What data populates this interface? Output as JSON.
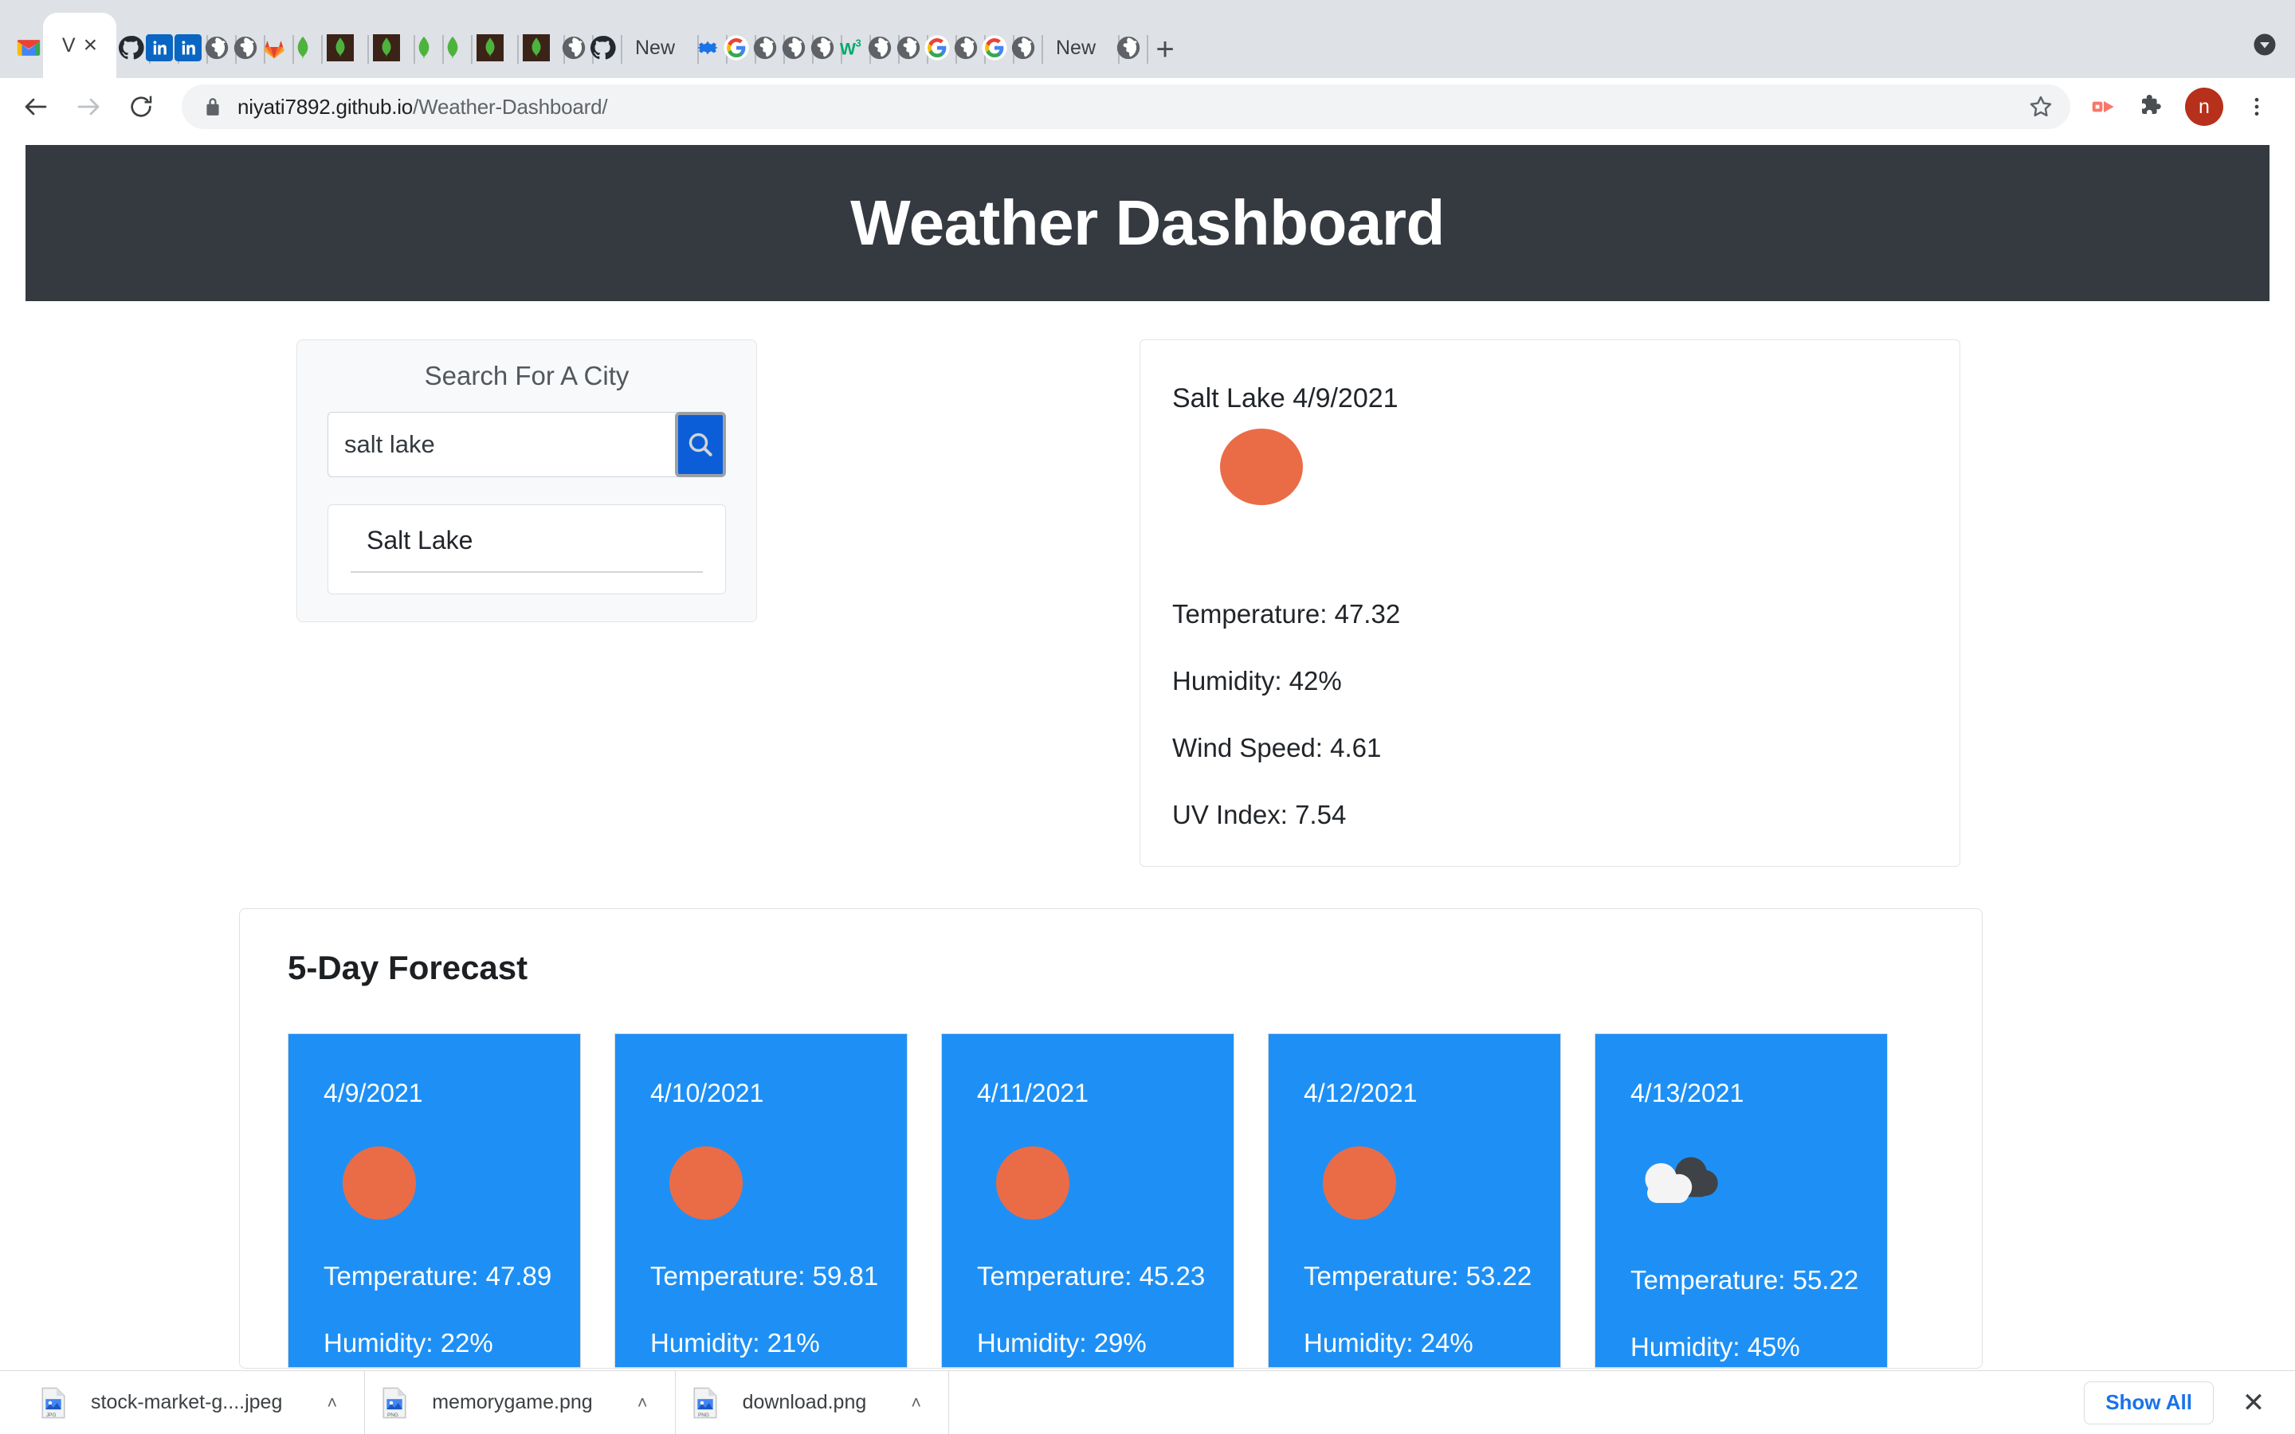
{
  "browser": {
    "tabs": [
      {
        "icon": "gmail-icon",
        "label": ""
      },
      {
        "icon": "favicon-generic",
        "label": "",
        "pinned": true
      },
      {
        "icon": "github-icon",
        "label": ""
      },
      {
        "icon": "linkedin-icon",
        "label": ""
      },
      {
        "icon": "linkedin-icon",
        "label": ""
      },
      {
        "icon": "globe-icon",
        "label": ""
      },
      {
        "icon": "globe-icon",
        "label": ""
      },
      {
        "icon": "gitlab-icon",
        "label": ""
      },
      {
        "icon": "mongodb-icon",
        "label": ""
      },
      {
        "icon": "mongodb-dark-icon",
        "label": ""
      },
      {
        "icon": "mongodb-dark-icon",
        "label": ""
      },
      {
        "icon": "mongodb-icon",
        "label": ""
      },
      {
        "icon": "mongodb-icon",
        "label": ""
      },
      {
        "icon": "mongodb-dark-icon",
        "label": ""
      },
      {
        "icon": "mongodb-dark-icon",
        "label": ""
      },
      {
        "icon": "globe-icon",
        "label": ""
      },
      {
        "icon": "github-icon",
        "label": ""
      },
      {
        "icon": "text-tab",
        "label": "New"
      },
      {
        "icon": "gear-blue-icon",
        "label": ""
      },
      {
        "icon": "google-icon",
        "label": ""
      },
      {
        "icon": "globe-icon",
        "label": ""
      },
      {
        "icon": "globe-icon",
        "label": ""
      },
      {
        "icon": "globe-icon",
        "label": ""
      },
      {
        "icon": "w3schools-icon",
        "label": ""
      },
      {
        "icon": "globe-icon",
        "label": ""
      },
      {
        "icon": "globe-icon",
        "label": ""
      },
      {
        "icon": "google-icon",
        "label": ""
      },
      {
        "icon": "globe-icon",
        "label": ""
      },
      {
        "icon": "google-icon",
        "label": ""
      },
      {
        "icon": "globe-icon",
        "label": ""
      },
      {
        "icon": "text-tab",
        "label": "New"
      },
      {
        "icon": "globe-icon",
        "label": ""
      }
    ],
    "active_tab": {
      "favicon_letter": "V",
      "close_label": "×"
    },
    "new_tab_label": "+",
    "toolbar": {
      "back_label": "←",
      "forward_label": "→",
      "reload_label": "↻",
      "url_host": "niyati7892.github.io",
      "url_path": "/Weather-Dashboard/",
      "lock_icon": "lock-icon",
      "star_icon": "bookmark-star-icon",
      "cast_icon": "media-cast-icon",
      "extensions_icon": "puzzle-icon",
      "profile_initial": "n",
      "menu_icon": "three-dot-menu-icon"
    }
  },
  "page": {
    "header_title": "Weather Dashboard",
    "search": {
      "title": "Search For A City",
      "input_value": "salt lake",
      "input_placeholder": "Search For A City",
      "button_icon": "search-icon",
      "history": [
        "Salt Lake"
      ]
    },
    "current": {
      "heading": "Salt Lake 4/9/2021",
      "icon": "sun-icon",
      "temperature": "Temperature: 47.32",
      "humidity": "Humidity: 42%",
      "wind_speed": "Wind Speed: 4.61",
      "uv_index": "UV Index: 7.54"
    },
    "forecast": {
      "title": "5-Day Forecast",
      "days": [
        {
          "date": "4/9/2021",
          "icon": "sun-icon",
          "temperature": "Temperature: 47.89",
          "humidity": "Humidity: 22%"
        },
        {
          "date": "4/10/2021",
          "icon": "sun-icon",
          "temperature": "Temperature: 59.81",
          "humidity": "Humidity: 21%"
        },
        {
          "date": "4/11/2021",
          "icon": "sun-icon",
          "temperature": "Temperature: 45.23",
          "humidity": "Humidity: 29%"
        },
        {
          "date": "4/12/2021",
          "icon": "sun-icon",
          "temperature": "Temperature: 53.22",
          "humidity": "Humidity: 24%"
        },
        {
          "date": "4/13/2021",
          "icon": "cloud-icon",
          "temperature": "Temperature: 55.22",
          "humidity": "Humidity: 45%"
        }
      ]
    }
  },
  "downloads": {
    "items": [
      {
        "name": "stock-market-g....jpeg",
        "icon": "jpeg-file-icon",
        "caret": "˄"
      },
      {
        "name": "memorygame.png",
        "icon": "png-file-icon",
        "caret": "˄"
      },
      {
        "name": "download.png",
        "icon": "png-file-icon",
        "caret": "˄"
      }
    ],
    "show_all_label": "Show All",
    "close_label": "✕"
  },
  "colors": {
    "header_bg": "#343a40",
    "forecast_card_bg": "#1e90f5",
    "sun": "#ea6c47",
    "search_button": "#0b5ed7",
    "link": "#1a73e8"
  }
}
